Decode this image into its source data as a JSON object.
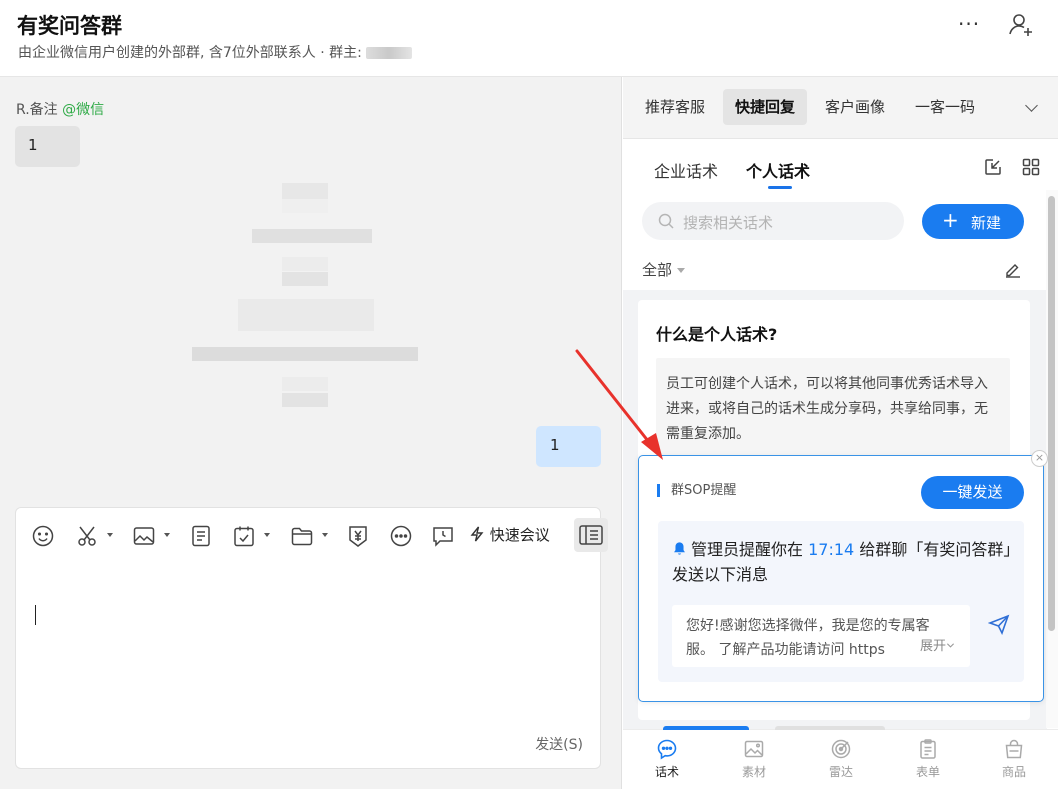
{
  "header": {
    "title": "有奖问答群",
    "subtitle": "由企业微信用户创建的外部群, 含7位外部联系人 · 群主:",
    "more": "···"
  },
  "chat": {
    "sender_name": "R.备注",
    "sender_tag": "@微信",
    "incoming_message": "1",
    "outgoing_message": "1"
  },
  "composer": {
    "quick_meeting_label": "快速会议",
    "send_label": "发送(S)"
  },
  "panel": {
    "top_tabs": [
      {
        "label": "推荐客服",
        "active": false
      },
      {
        "label": "快捷回复",
        "active": true
      },
      {
        "label": "客户画像",
        "active": false
      },
      {
        "label": "一客一码",
        "active": false
      }
    ],
    "sub_tabs": [
      {
        "label": "企业话术",
        "active": false
      },
      {
        "label": "个人话术",
        "active": true
      }
    ],
    "search_placeholder": "搜索相关话术",
    "new_button": "新建",
    "filter_label": "全部",
    "card": {
      "title": "什么是个人话术?",
      "description": "员工可创建个人话术，可以将其他同事优秀话术导入进来，或将自己的话术生成分享码，共享给同事，无需重复添加。"
    }
  },
  "sop": {
    "label": "群SOP提醒",
    "send_button": "一键发送",
    "message_prefix": "管理员提醒你在",
    "time": "17:14",
    "message_suffix": "给群聊「有奖问答群」发送以下消息",
    "preview_text": "您好!感谢您选择微伴，我是您的专属客服。 了解产品功能请访问 https",
    "expand_label": "展开"
  },
  "bottom_nav": [
    {
      "label": "话术",
      "icon": "chat-bubble-icon",
      "active": true
    },
    {
      "label": "素材",
      "icon": "image-icon",
      "active": false
    },
    {
      "label": "雷达",
      "icon": "radar-icon",
      "active": false
    },
    {
      "label": "表单",
      "icon": "clipboard-icon",
      "active": false
    },
    {
      "label": "商品",
      "icon": "shopping-bag-icon",
      "active": false
    }
  ],
  "colors": {
    "accent": "#1a7cf0",
    "wechat_green": "#2eaa46",
    "arrow_red": "#e8322c",
    "outgoing_bubble": "#cfe6ff"
  }
}
